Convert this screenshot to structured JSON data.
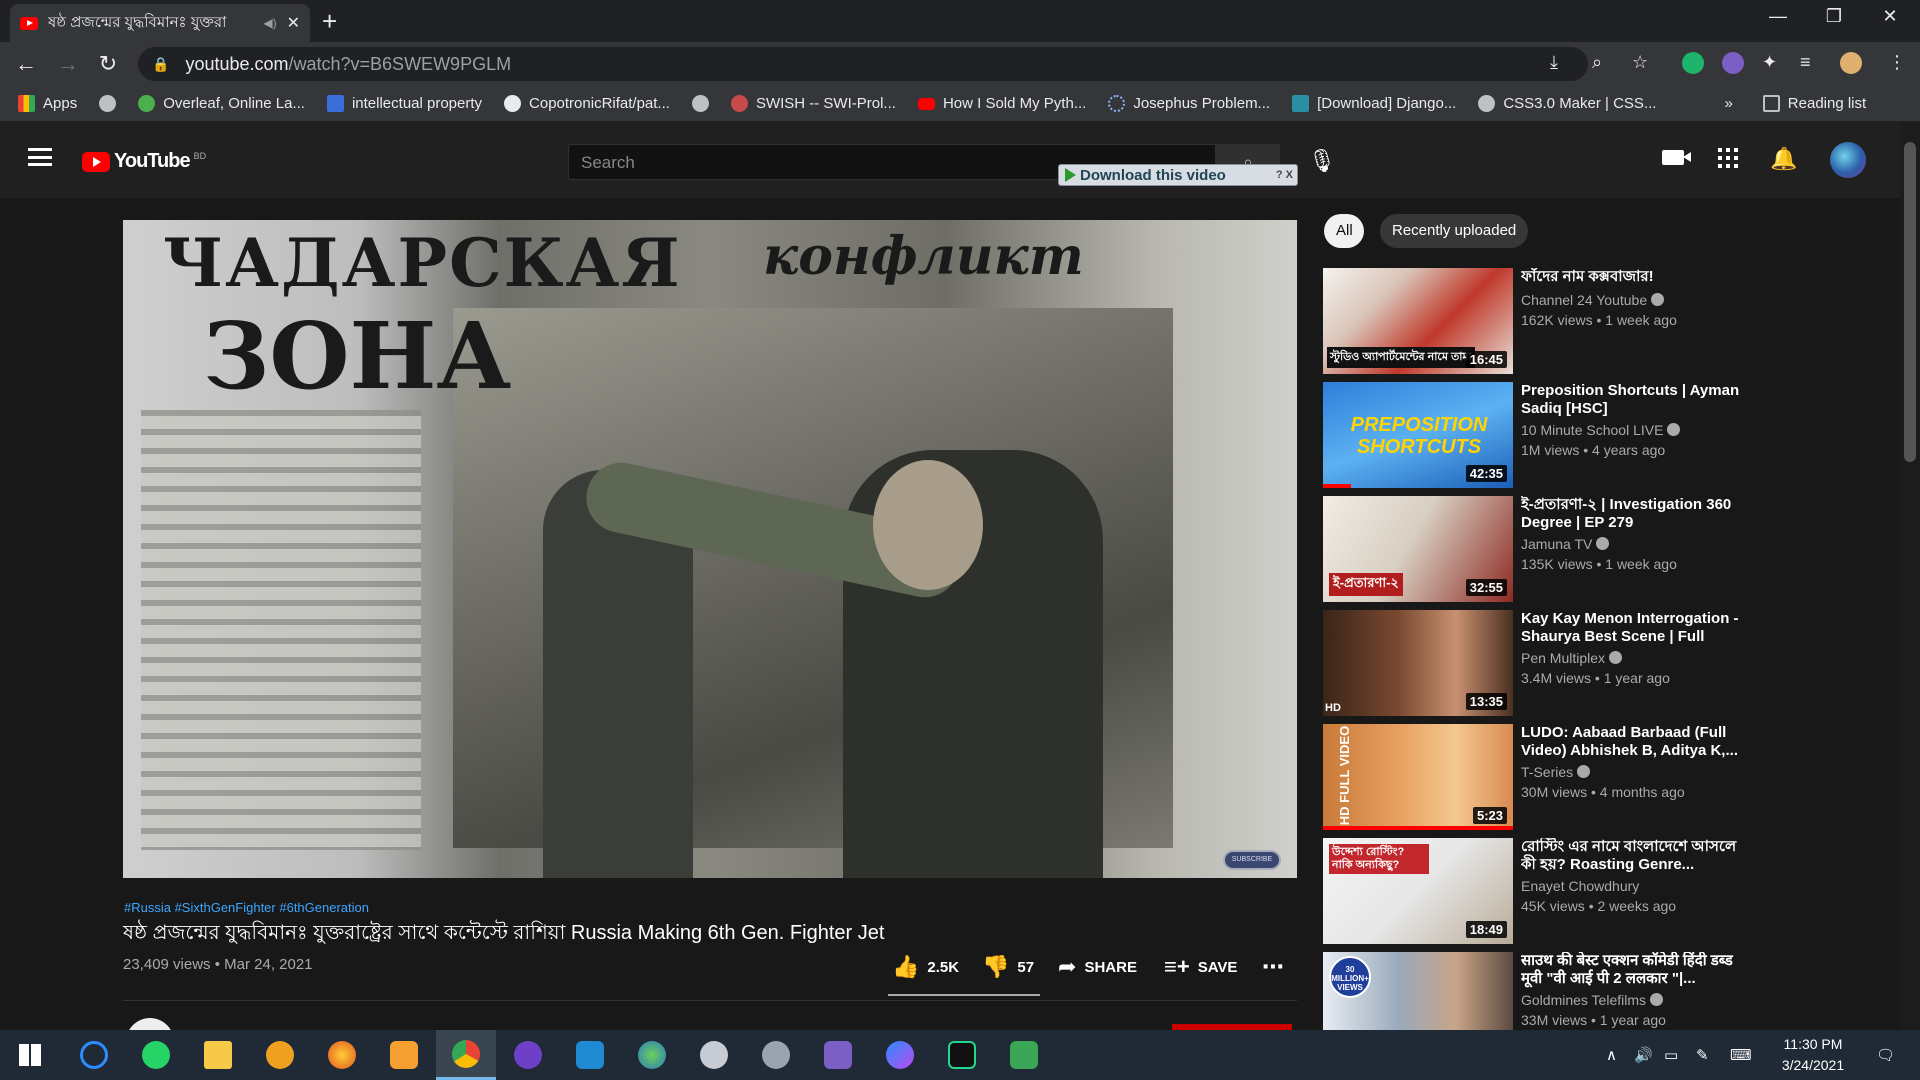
{
  "browser": {
    "tab_title": "ষষ্ঠ প্রজন্মের যুদ্ধবিমানঃ যুক্তরা",
    "url_host": "youtube.com",
    "url_path": "/watch?v=B6SWEW9PGLM",
    "bookmarks": [
      "Apps",
      "Overleaf, Online La...",
      "intellectual property",
      "CopotronicRifat/pat...",
      "SWISH -- SWI-Prol...",
      "How I Sold My Pyth...",
      "Josephus Problem...",
      "[Download] Django...",
      "CSS3.0 Maker | CSS...",
      "»",
      "Reading list"
    ]
  },
  "youtube": {
    "logo_text": "YouTube",
    "country_code": "BD",
    "search_placeholder": "Search",
    "download_label": "Download this video",
    "download_mini": "? X"
  },
  "video": {
    "headline_left": "ЧАДАРСКАЯ",
    "headline_right": "конфликт",
    "headline_big": "ЗОНА",
    "subscribe_badge": "SUBSCRIBE",
    "hashtags": "#Russia #SixthGenFighter #6thGeneration",
    "title": "ষষ্ঠ প্রজন্মের যুদ্ধবিমানঃ যুক্তরাষ্ট্রের সাথে কন্টেস্টে রাশিয়া Russia Making 6th Gen. Fighter Jet",
    "views_date": "23,409 views • Mar 24, 2021",
    "likes": "2.5K",
    "dislikes": "57",
    "share": "SHARE",
    "save": "SAVE"
  },
  "chips": [
    "All",
    "Recently uploaded"
  ],
  "recommendations": [
    {
      "title": "ফাঁদের নাম কক্সবাজার!",
      "channel": "Channel 24 Youtube",
      "verified": true,
      "meta": "162K views • 1 week ago",
      "duration": "16:45",
      "thumb_text": "স্টুডিও অ্যাপার্টমেন্টের নামে তামা"
    },
    {
      "title": "Preposition Shortcuts | Ayman Sadiq [HSC]",
      "channel": "10 Minute School LIVE",
      "verified": true,
      "meta": "1M views • 4 years ago",
      "duration": "42:35",
      "thumb_text": "PREPOSITION SHORTCUTS"
    },
    {
      "title": "ই-প্রতারণা-২ | Investigation 360 Degree | EP 279",
      "channel": "Jamuna TV",
      "verified": true,
      "meta": "135K views • 1 week ago",
      "duration": "32:55",
      "thumb_text": "ই-প্রতারণা-২"
    },
    {
      "title": "Kay Kay Menon Interrogation - Shaurya Best Scene | Full Hind...",
      "channel": "Pen Multiplex",
      "verified": true,
      "meta": "3.4M views • 1 year ago",
      "duration": "13:35",
      "thumb_text": "HD"
    },
    {
      "title": "LUDO: Aabaad Barbaad (Full Video) Abhishek B, Aditya K,...",
      "channel": "T-Series",
      "verified": true,
      "meta": "30M views • 4 months ago",
      "duration": "5:23",
      "thumb_text": "HD FULL VIDEO"
    },
    {
      "title": "রোস্টিং এর নামে বাংলাদেশে আসলে কী হয়? Roasting Genre...",
      "channel": "Enayet Chowdhury",
      "verified": false,
      "meta": "45K views • 2 weeks ago",
      "duration": "18:49",
      "thumb_text": "উদ্দেশ্য রোস্টিং? নাকি অন্যকিছু?"
    },
    {
      "title": "साउथ की बेस्ट एक्शन कॉमेडी हिंदी डब्ड मूवी \"वी आई पी 2 ललकार \"|...",
      "channel": "Goldmines Telefilms",
      "verified": true,
      "meta": "33M views • 1 year ago",
      "duration": "",
      "thumb_text": "30 MILLION+ VIEWS"
    }
  ],
  "taskbar": {
    "time": "11:30 PM",
    "date": "3/24/2021"
  },
  "colors": {
    "yt_red": "#ff0000",
    "link_blue": "#3ea6ff",
    "page_bg": "#181818",
    "header_bg": "#202020"
  }
}
